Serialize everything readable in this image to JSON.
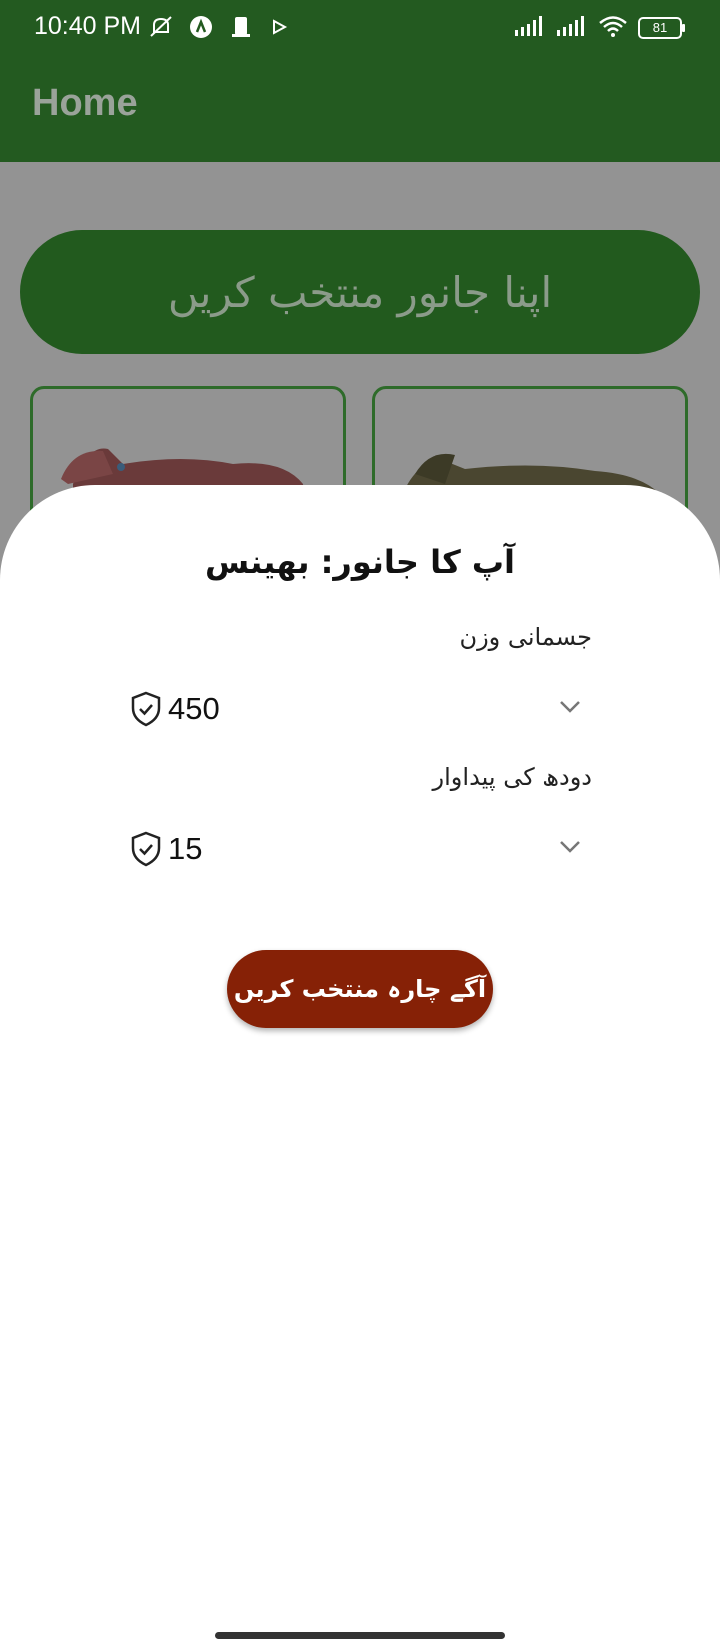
{
  "status_bar": {
    "time": "10:40 PM",
    "battery": "81",
    "icons_left": [
      "mute-icon",
      "alpha-icon",
      "sim-icon",
      "play-icon"
    ],
    "icons_right": [
      "signal-icon",
      "signal-icon",
      "wifi-icon",
      "battery-icon"
    ]
  },
  "app_bar": {
    "title": "Home"
  },
  "background": {
    "select_animal_banner": "اپنا جانور منتخب کریں",
    "cards": [
      "cow-image",
      "buffalo-image"
    ]
  },
  "sheet": {
    "title": "آپ کا جانور:  بھینس",
    "body_weight": {
      "label": "جسمانی وزن",
      "value": "450"
    },
    "milk_production": {
      "label": "دودھ کی پیداوار",
      "value": "15"
    },
    "next_button": "آگے چارہ منتخب کریں"
  },
  "colors": {
    "primary_green": "#235a20",
    "button_brown": "#862106",
    "overlay_grey": "#939393"
  }
}
